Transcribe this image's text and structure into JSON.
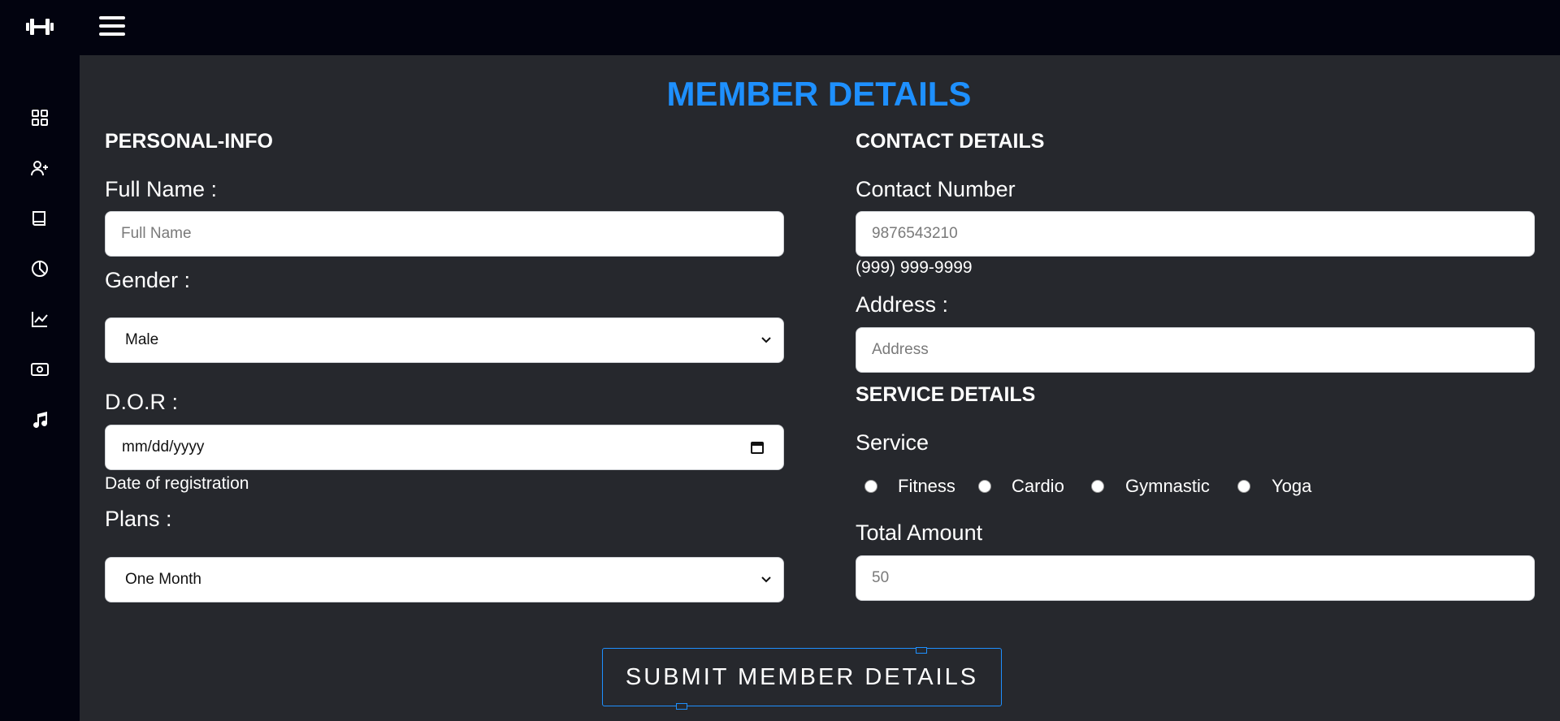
{
  "header": {
    "logo_icon": "dumbbell-h-icon",
    "menu_icon": "hamburger-icon"
  },
  "sidebar": {
    "items": [
      {
        "icon": "dashboard-grid-icon"
      },
      {
        "icon": "add-user-icon"
      },
      {
        "icon": "book-icon"
      },
      {
        "icon": "pie-chart-icon"
      },
      {
        "icon": "line-chart-icon"
      },
      {
        "icon": "money-icon"
      },
      {
        "icon": "music-icon"
      }
    ]
  },
  "page": {
    "title": "MEMBER DETAILS",
    "accent": "#1e90ff"
  },
  "personal": {
    "section_title": "PERSONAL-INFO",
    "full_name_label": "Full Name :",
    "full_name_placeholder": "Full Name",
    "gender_label": "Gender :",
    "gender_value": "Male",
    "dor_label": "D.O.R :",
    "dor_value": "mm/dd/yyyy",
    "dor_hint": "Date of registration",
    "plans_label": "Plans :",
    "plans_value": "One Month"
  },
  "contact": {
    "section_title": "CONTACT DETAILS",
    "number_label": "Contact Number",
    "number_placeholder": "9876543210",
    "number_hint": "(999) 999-9999",
    "address_label": "Address :",
    "address_placeholder": "Address"
  },
  "service": {
    "section_title": "SERVICE DETAILS",
    "label": "Service",
    "options": [
      "Fitness",
      "Cardio",
      "Gymnastic",
      "Yoga"
    ],
    "amount_label": "Total Amount",
    "amount_placeholder": "50"
  },
  "submit": {
    "label": "SUBMIT MEMBER DETAILS"
  }
}
